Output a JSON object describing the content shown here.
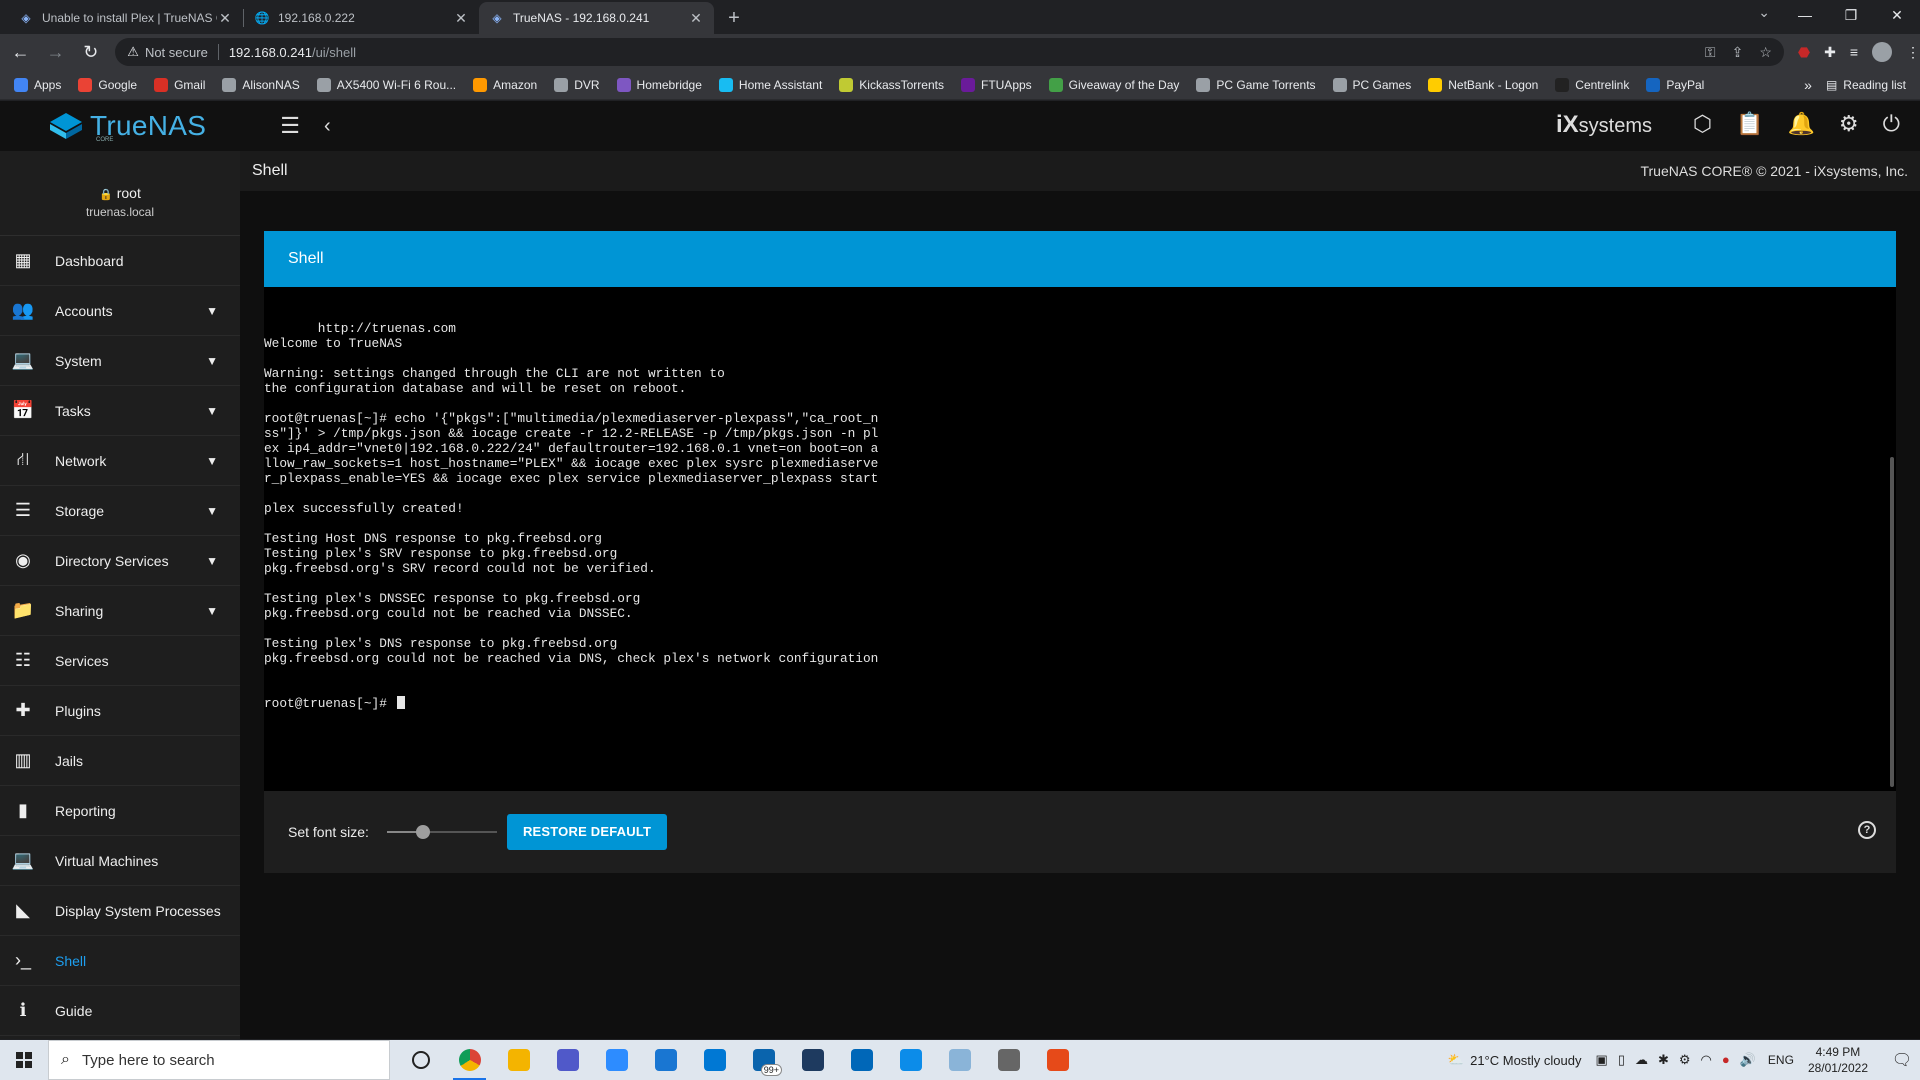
{
  "browser": {
    "tabs": [
      {
        "title": "Unable to install Plex | TrueNAS C",
        "icon": "truenas-icon",
        "active": false
      },
      {
        "title": "192.168.0.222",
        "icon": "globe-icon",
        "active": false
      },
      {
        "title": "TrueNAS - 192.168.0.241",
        "icon": "truenas-icon",
        "active": true
      }
    ],
    "new_tab": "+",
    "address": {
      "security_label": "Not secure",
      "host": "192.168.0.241",
      "path": "/ui/shell"
    },
    "bookmarks": [
      {
        "label": "Apps",
        "color": "#4285f4"
      },
      {
        "label": "Google",
        "color": "#ea4335"
      },
      {
        "label": "Gmail",
        "color": "#d93025"
      },
      {
        "label": "AlisonNAS",
        "color": "#9aa0a6"
      },
      {
        "label": "AX5400 Wi-Fi 6 Rou...",
        "color": "#9aa0a6"
      },
      {
        "label": "Amazon",
        "color": "#ff9900"
      },
      {
        "label": "DVR",
        "color": "#9aa0a6"
      },
      {
        "label": "Homebridge",
        "color": "#7e57c2"
      },
      {
        "label": "Home Assistant",
        "color": "#18bcf2"
      },
      {
        "label": "KickassTorrents",
        "color": "#c0ca33"
      },
      {
        "label": "FTUApps",
        "color": "#6a1b9a"
      },
      {
        "label": "Giveaway of the Day",
        "color": "#43a047"
      },
      {
        "label": "PC Game Torrents",
        "color": "#9aa0a6"
      },
      {
        "label": "PC Games",
        "color": "#9aa0a6"
      },
      {
        "label": "NetBank - Logon",
        "color": "#ffcc00"
      },
      {
        "label": "Centrelink",
        "color": "#222222"
      },
      {
        "label": "PayPal",
        "color": "#1565c0"
      }
    ],
    "bookmarks_more": "»",
    "reading_list": "Reading list"
  },
  "app": {
    "brand": "TrueNAS",
    "brand_sub": "CORE",
    "vendor": "iX",
    "vendor_suffix": "systems",
    "user": {
      "name": "root",
      "host": "truenas.local"
    },
    "page_title": "Shell",
    "copyright": "TrueNAS CORE® © 2021 - iXsystems, Inc.",
    "nav": [
      {
        "label": "Dashboard",
        "icon": "dashboard-icon",
        "glyph": "▦",
        "has_caret": false,
        "active": false
      },
      {
        "label": "Accounts",
        "icon": "accounts-icon",
        "glyph": "👥",
        "has_caret": true,
        "active": false
      },
      {
        "label": "System",
        "icon": "system-icon",
        "glyph": "💻",
        "has_caret": true,
        "active": false
      },
      {
        "label": "Tasks",
        "icon": "tasks-icon",
        "glyph": "📅",
        "has_caret": true,
        "active": false
      },
      {
        "label": "Network",
        "icon": "network-icon",
        "glyph": "⛙",
        "has_caret": true,
        "active": false
      },
      {
        "label": "Storage",
        "icon": "storage-icon",
        "glyph": "☰",
        "has_caret": true,
        "active": false
      },
      {
        "label": "Directory Services",
        "icon": "directory-services-icon",
        "glyph": "◉",
        "has_caret": true,
        "active": false
      },
      {
        "label": "Sharing",
        "icon": "sharing-icon",
        "glyph": "📁",
        "has_caret": true,
        "active": false
      },
      {
        "label": "Services",
        "icon": "services-icon",
        "glyph": "☷",
        "has_caret": false,
        "active": false
      },
      {
        "label": "Plugins",
        "icon": "plugins-icon",
        "glyph": "✚",
        "has_caret": false,
        "active": false
      },
      {
        "label": "Jails",
        "icon": "jails-icon",
        "glyph": "▥",
        "has_caret": false,
        "active": false
      },
      {
        "label": "Reporting",
        "icon": "reporting-icon",
        "glyph": "▮",
        "has_caret": false,
        "active": false
      },
      {
        "label": "Virtual Machines",
        "icon": "virtual-machines-icon",
        "glyph": "💻",
        "has_caret": false,
        "active": false
      },
      {
        "label": "Display System Processes",
        "icon": "processes-icon",
        "glyph": "◣",
        "has_caret": false,
        "active": false
      },
      {
        "label": "Shell",
        "icon": "shell-icon",
        "glyph": "›_",
        "has_caret": false,
        "active": true
      },
      {
        "label": "Guide",
        "icon": "guide-icon",
        "glyph": "ℹ",
        "has_caret": false,
        "active": false
      }
    ],
    "shell": {
      "card_title": "Shell",
      "lines": [
        "       http://truenas.com",
        "Welcome to TrueNAS",
        "",
        "Warning: settings changed through the CLI are not written to",
        "the configuration database and will be reset on reboot.",
        "",
        "root@truenas[~]# echo '{\"pkgs\":[\"multimedia/plexmediaserver-plexpass\",\"ca_root_n",
        "ss\"]}' > /tmp/pkgs.json && iocage create -r 12.2-RELEASE -p /tmp/pkgs.json -n pl",
        "ex ip4_addr=\"vnet0|192.168.0.222/24\" defaultrouter=192.168.0.1 vnet=on boot=on a",
        "llow_raw_sockets=1 host_hostname=\"PLEX\" && iocage exec plex sysrc plexmediaserve",
        "r_plexpass_enable=YES && iocage exec plex service plexmediaserver_plexpass start",
        "",
        "plex successfully created!",
        "",
        "Testing Host DNS response to pkg.freebsd.org",
        "Testing plex's SRV response to pkg.freebsd.org",
        "pkg.freebsd.org's SRV record could not be verified.",
        "",
        "Testing plex's DNSSEC response to pkg.freebsd.org",
        "pkg.freebsd.org could not be reached via DNSSEC.",
        "",
        "Testing plex's DNS response to pkg.freebsd.org",
        "pkg.freebsd.org could not be reached via DNS, check plex's network configuration"
      ],
      "prompt": "root@truenas[~]# ",
      "font_size_label": "Set font size:",
      "font_size_level": 0.33,
      "restore_label": "RESTORE DEFAULT"
    }
  },
  "taskbar": {
    "search_placeholder": "Type here to search",
    "apps": [
      {
        "name": "task-view-icon",
        "color": "#222222",
        "open": false
      },
      {
        "name": "chrome-icon",
        "color": "#db4437",
        "open": true
      },
      {
        "name": "file-explorer-icon",
        "color": "#f4b400",
        "open": false
      },
      {
        "name": "teams-icon",
        "color": "#5059c9",
        "open": false
      },
      {
        "name": "zoom-icon",
        "color": "#2d8cff",
        "open": false
      },
      {
        "name": "app-icon",
        "color": "#1976d2",
        "open": false
      },
      {
        "name": "calendar-icon",
        "color": "#0078d4",
        "open": false
      },
      {
        "name": "mail-icon",
        "color": "#0a64ad",
        "open": false
      },
      {
        "name": "app2-icon",
        "color": "#1e3a5f",
        "open": false
      },
      {
        "name": "store-icon",
        "color": "#0067b8",
        "open": false
      },
      {
        "name": "edge-icon",
        "color": "#0c8ce9",
        "open": false
      },
      {
        "name": "settings-app-icon",
        "color": "#8ab4d8",
        "open": false
      },
      {
        "name": "app3-icon",
        "color": "#666666",
        "open": false
      },
      {
        "name": "flash-icon",
        "color": "#e64a19",
        "open": false
      }
    ],
    "mail_badge": "99+",
    "weather": "21°C  Mostly cloudy",
    "lang": "ENG",
    "time": "4:49 PM",
    "date": "28/01/2022"
  }
}
